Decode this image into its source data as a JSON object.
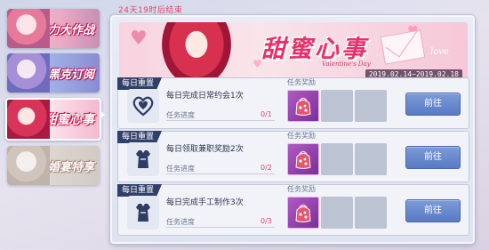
{
  "sidebar": {
    "tabs": [
      {
        "label": "巧克力大作战"
      },
      {
        "label": "黑克订阅"
      },
      {
        "label": "甜蜜心事"
      },
      {
        "label": "婚宴特享"
      }
    ],
    "active_index": 2
  },
  "countdown": "24天19时后结束",
  "banner": {
    "title": "甜蜜心事",
    "subtitle": "Valentine's Day",
    "love": "love",
    "date_range": "2019.02.14~2019.02.18"
  },
  "tasks": [
    {
      "reset_label": "每日重置",
      "reward_label": "任务奖励",
      "title": "每日完成日常约会1次",
      "progress_label": "任务进度",
      "progress": "0/1",
      "button": "前往",
      "icon": "heart-emblem-icon"
    },
    {
      "reset_label": "每日重置",
      "reward_label": "任务奖励",
      "title": "每日领取兼职奖励2次",
      "progress_label": "任务进度",
      "progress": "0/2",
      "button": "前往",
      "icon": "outfit-icon"
    },
    {
      "reset_label": "每日重置",
      "reward_label": "任务奖励",
      "title": "每日完成手工制作3次",
      "progress_label": "任务进度",
      "progress": "0/3",
      "button": "前往",
      "icon": "outfit-icon"
    }
  ],
  "colors": {
    "accent_pink": "#e8306a",
    "tag_navy": "#31406a",
    "button_blue": "#5a7ac3",
    "reward_purple": "#9a44b4"
  }
}
